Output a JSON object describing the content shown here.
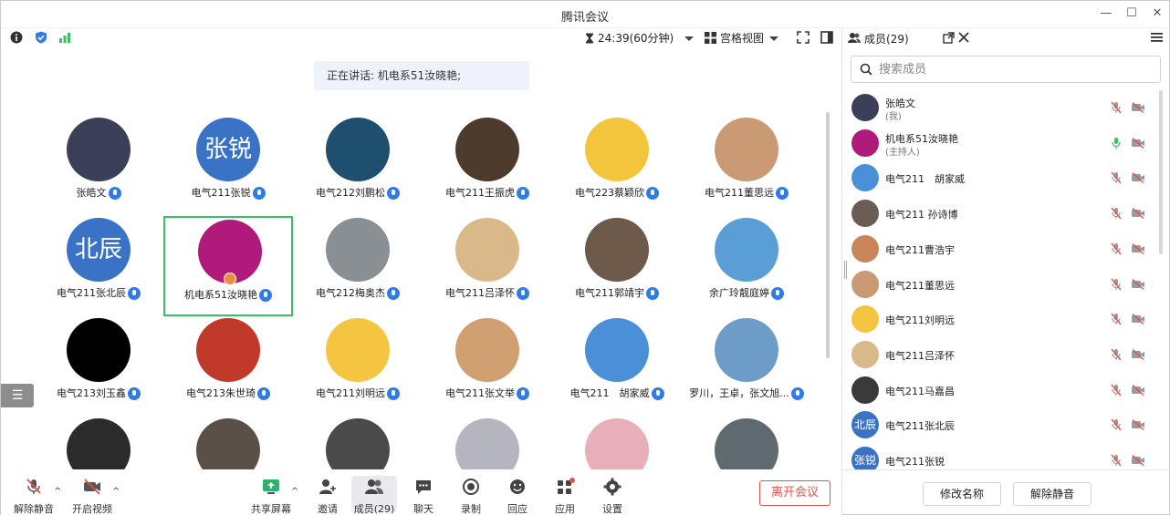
{
  "window": {
    "title": "腾讯会议"
  },
  "toolbar": {
    "timer": "24:39(60分钟)",
    "view_mode": "宫格视图"
  },
  "speaking_banner": "正在讲话: 机电系51汝晓艳;",
  "participants": [
    {
      "name": "张皓文",
      "avatar_text": "",
      "avatar_color": "#3b3f58"
    },
    {
      "name": "电气211张锐",
      "avatar_text": "张锐",
      "avatar_color": "#3a72c5"
    },
    {
      "name": "电气212刘鹏松",
      "avatar_text": "",
      "avatar_color": "#1e4f6e"
    },
    {
      "name": "电气211王振虎",
      "avatar_text": "",
      "avatar_color": "#4d3b2e"
    },
    {
      "name": "电气223蔡颖欣",
      "avatar_text": "",
      "avatar_color": "#f2c53d"
    },
    {
      "name": "电气211董思远",
      "avatar_text": "",
      "avatar_color": "#c99a74"
    },
    {
      "name": "电气211张北辰",
      "avatar_text": "北辰",
      "avatar_color": "#3a72c5"
    },
    {
      "name": "机电系51汝晓艳",
      "avatar_text": "",
      "avatar_color": "#b01a7a",
      "active": true,
      "host": true
    },
    {
      "name": "电气212梅奥杰",
      "avatar_text": "",
      "avatar_color": "#8a8f94"
    },
    {
      "name": "电气211吕泽怀",
      "avatar_text": "",
      "avatar_color": "#d9b98a"
    },
    {
      "name": "电气211郭靖宇",
      "avatar_text": "",
      "avatar_color": "#6e5a4a"
    },
    {
      "name": "余广玲靓庭婷",
      "avatar_text": "",
      "avatar_color": "#5a9ed6"
    },
    {
      "name": "电气213刘玉鑫",
      "avatar_text": "",
      "avatar_color": "#000000"
    },
    {
      "name": "电气213朱世琦",
      "avatar_text": "",
      "avatar_color": "#c0392b"
    },
    {
      "name": "电气211刘明远",
      "avatar_text": "",
      "avatar_color": "#f5c542"
    },
    {
      "name": "电气211张文举",
      "avatar_text": "",
      "avatar_color": "#d0a070"
    },
    {
      "name": "电气211　胡家威",
      "avatar_text": "",
      "avatar_color": "#4a90d9"
    },
    {
      "name": "罗川，王卓，张文旭...",
      "avatar_text": "",
      "avatar_color": "#6d9cc9"
    },
    {
      "name": "",
      "avatar_text": "",
      "avatar_color": "#2b2b2b"
    },
    {
      "name": "",
      "avatar_text": "",
      "avatar_color": "#5a5048"
    },
    {
      "name": "",
      "avatar_text": "",
      "avatar_color": "#4a4a4a"
    },
    {
      "name": "",
      "avatar_text": "",
      "avatar_color": "#b5b5c0"
    },
    {
      "name": "",
      "avatar_text": "",
      "avatar_color": "#e7b0b8"
    },
    {
      "name": "",
      "avatar_text": "",
      "avatar_color": "#5e6a70"
    }
  ],
  "bottombar": {
    "unmute": "解除静音",
    "start_video": "开启视频",
    "share_screen": "共享屏幕",
    "invite": "邀请",
    "members": "成员(29)",
    "chat": "聊天",
    "record": "录制",
    "react": "回应",
    "apps": "应用",
    "settings": "设置",
    "leave": "离开会议"
  },
  "panel": {
    "title": "成员(29)",
    "search_placeholder": "搜索成员",
    "members": [
      {
        "name": "张皓文",
        "sub": "(我)",
        "avatar_text": "",
        "avatar_color": "#3b3f58",
        "mic_on": false
      },
      {
        "name": "机电系51汝晓艳",
        "sub": "(主持人)",
        "avatar_text": "",
        "avatar_color": "#b01a7a",
        "mic_on": true
      },
      {
        "name": "电气211　胡家威",
        "sub": "",
        "avatar_text": "",
        "avatar_color": "#4a90d9",
        "mic_on": false
      },
      {
        "name": "电气211 孙诗博",
        "sub": "",
        "avatar_text": "",
        "avatar_color": "#6b5d55",
        "mic_on": false
      },
      {
        "name": "电气211曹浩宇",
        "sub": "",
        "avatar_text": "",
        "avatar_color": "#c9855a",
        "mic_on": false
      },
      {
        "name": "电气211董思远",
        "sub": "",
        "avatar_text": "",
        "avatar_color": "#c99a74",
        "mic_on": false
      },
      {
        "name": "电气211刘明远",
        "sub": "",
        "avatar_text": "",
        "avatar_color": "#f5c542",
        "mic_on": false
      },
      {
        "name": "电气211吕泽怀",
        "sub": "",
        "avatar_text": "",
        "avatar_color": "#d9b98a",
        "mic_on": false
      },
      {
        "name": "电气211马嘉昌",
        "sub": "",
        "avatar_text": "",
        "avatar_color": "#3a3a3a",
        "mic_on": false
      },
      {
        "name": "电气211张北辰",
        "sub": "",
        "avatar_text": "北辰",
        "avatar_color": "#3a72c5",
        "mic_on": false
      },
      {
        "name": "电气211张锐",
        "sub": "",
        "avatar_text": "张锐",
        "avatar_color": "#3a72c5",
        "mic_on": false
      }
    ],
    "rename_button": "修改名称",
    "unmute_button": "解除静音"
  },
  "colors": {
    "accent": "#2f7be8",
    "leave": "#e0524c",
    "active_border": "#3cbf63",
    "mic_on": "#3cbf63",
    "mic_off": "#e0524c"
  }
}
